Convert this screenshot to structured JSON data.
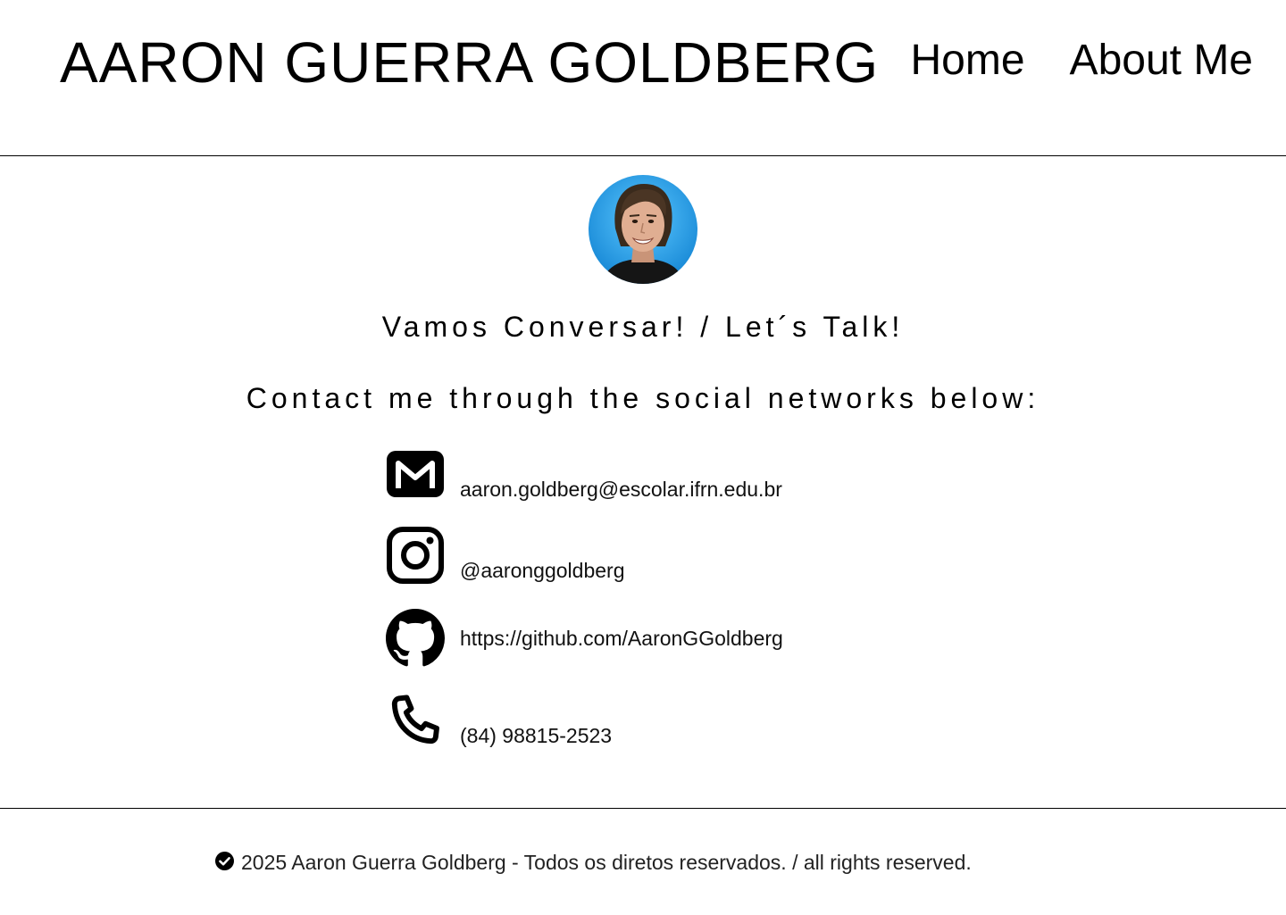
{
  "header": {
    "site_title": "AARON GUERRA GOLDBERG",
    "nav": [
      {
        "label": "Home"
      },
      {
        "label": "About Me"
      }
    ]
  },
  "profile": {
    "avatar_alt": "Aaron Guerra Goldberg profile photo"
  },
  "main": {
    "heading_1": "Vamos Conversar! / Let´s Talk!",
    "heading_2": "Contact me through the social networks below:"
  },
  "contacts": [
    {
      "icon": "gmail-icon",
      "text": "aaron.goldberg@escolar.ifrn.edu.br"
    },
    {
      "icon": "instagram-icon",
      "text": "@aaronggoldberg"
    },
    {
      "icon": "github-icon",
      "text": "https://github.com/AaronGGoldberg"
    },
    {
      "icon": "phone-icon",
      "text": "(84) 98815-2523"
    }
  ],
  "footer": {
    "icon": "check-circle-icon",
    "text": "2025 Aaron Guerra Goldberg - Todos os diretos reservados. / all rights reserved."
  },
  "colors": {
    "background": "#ffffff",
    "text": "#000000",
    "avatar_bg": "#1e9be6"
  }
}
